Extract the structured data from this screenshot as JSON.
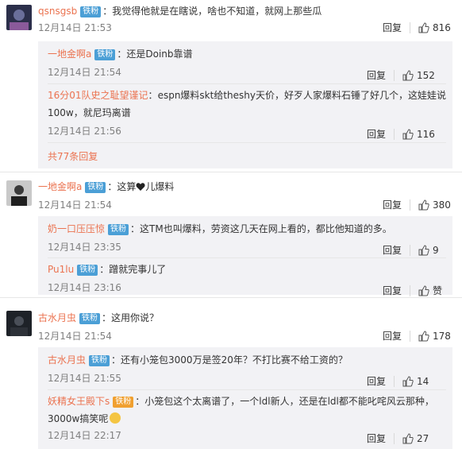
{
  "badge_label": "铁粉",
  "reply_label": "回复",
  "comments": [
    {
      "user": "qsnsgsb",
      "sep": "：",
      "text": "我觉得他就是在瞎说，啥也不知道，就网上那些瓜",
      "time": "12月14日 21:53",
      "likes": "816",
      "replies": [
        {
          "user": "一地金啊a",
          "sep": "：",
          "text": "还是Doinb靠谱",
          "time": "12月14日 21:54",
          "likes": "152"
        },
        {
          "user": "16分01队史之耻望谨记",
          "sep": "：",
          "text_line1": "espn爆料skt给theshy天价，好歹人家爆料石锤了好几个，这娃娃说",
          "text_line2": "100w，就尼玛离谱",
          "time": "12月14日 21:56",
          "likes": "116"
        }
      ],
      "more": "共77条回复"
    },
    {
      "user": "一地金啊a",
      "sep": "：",
      "text_before": "这算",
      "text_after": "儿爆料",
      "time": "12月14日 21:54",
      "likes": "380",
      "replies": [
        {
          "user": "奶一口压压惊",
          "sep": "：",
          "text": "这TM也叫爆料，劳资这几天在网上看的，都比他知道的多。",
          "time": "12月14日 23:35",
          "likes": "9"
        },
        {
          "user": "Pu1lu",
          "sep": "：",
          "text": "蹭就完事儿了",
          "time": "12月14日 23:16",
          "likes": "赞"
        }
      ]
    },
    {
      "user": "古水月虫",
      "sep": "：",
      "text": "这用你说？",
      "time": "12月14日 21:54",
      "likes": "178",
      "replies": [
        {
          "user": "古水月虫",
          "sep": "：",
          "text": "还有小笼包3000万是签20年？不打比赛不给工资的？",
          "time": "12月14日 21:55",
          "likes": "14"
        },
        {
          "user": "妖精女王殿下s",
          "sep": "：",
          "text_line1": "小笼包这个太离谱了，一个ldl新人，还是在ldl都不能叱咤风云那种，",
          "text_line2_before": "3000w搞笑呢",
          "time": "12月14日 22:17",
          "likes": "27"
        }
      ]
    }
  ]
}
